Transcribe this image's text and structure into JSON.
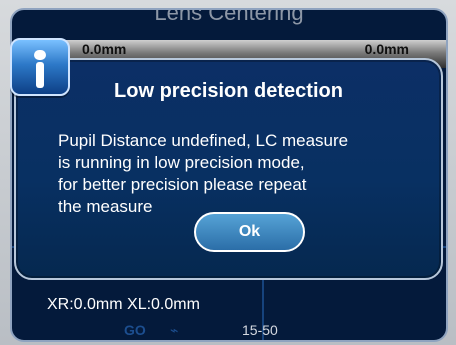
{
  "screen": {
    "title": "Lens Centering",
    "measure_left": "0.0mm",
    "measure_right": "0.0mm",
    "xr_xl": "XR:0.0mm    XL:0.0mm",
    "status": {
      "left": "GO",
      "wifi": "wifi",
      "time": "15-50"
    }
  },
  "modal": {
    "title": "Low precision detection",
    "message_lines": [
      "Pupil Distance undefined, LC measure",
      " is running in low precision mode,",
      "for better precision please repeat",
      "the measure"
    ],
    "ok_label": "Ok"
  },
  "icons": {
    "info": "info-icon",
    "wifi": "wifi-icon"
  },
  "colors": {
    "screen_bg": "#041a3b",
    "modal_bg": "#083062",
    "button": "#2b6ea8",
    "info_badge": "#2d79c8"
  }
}
